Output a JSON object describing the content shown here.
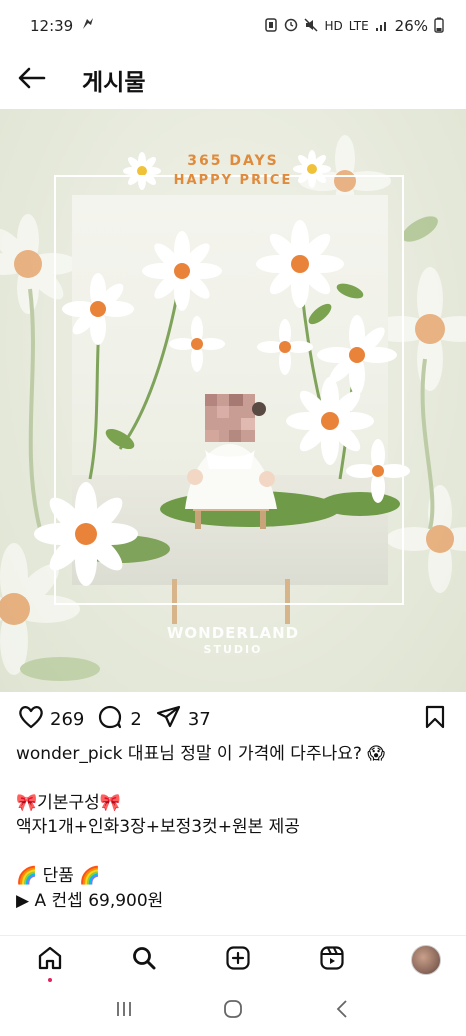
{
  "status": {
    "time": "12:39",
    "net_label": "HD",
    "lte_label": "LTE",
    "battery": "26%"
  },
  "header": {
    "title": "게시물"
  },
  "image": {
    "headline_top": "365 DAYS",
    "headline_bottom": "HAPPY PRICE",
    "brand": "WONDERLAND",
    "brand_sub": "STUDIO"
  },
  "actions": {
    "likes": "269",
    "comments": "2",
    "shares": "37"
  },
  "caption": {
    "lines": [
      "wonder_pick 대표님 정말 이 가격에 다주나요? 😱",
      "",
      "🎀기본구성🎀",
      "액자1개+인화3장+보정3컷+원본 제공",
      "",
      "🌈 단품 🌈",
      "▶ A 컨셉 69,900원"
    ]
  },
  "colors": {
    "accent_orange": "#e08a3c",
    "notification_dot": "#e0245e"
  }
}
